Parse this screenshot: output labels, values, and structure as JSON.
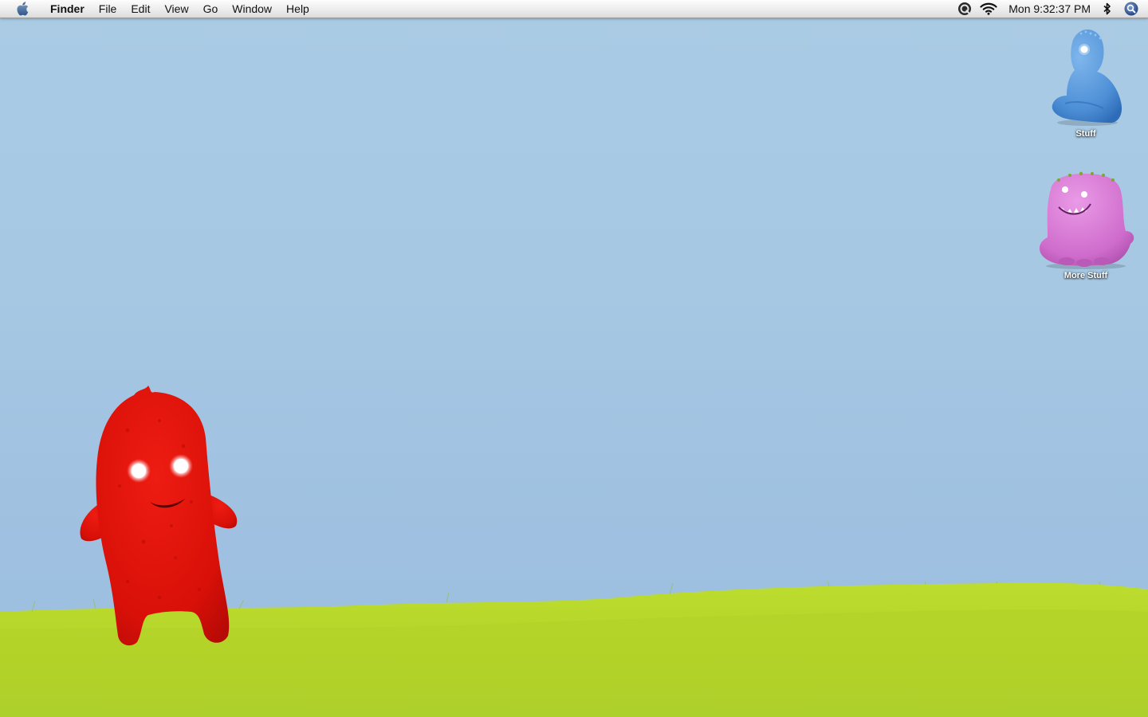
{
  "menubar": {
    "apple_icon": "apple-icon",
    "app_name": "Finder",
    "items": [
      "File",
      "Edit",
      "View",
      "Go",
      "Window",
      "Help"
    ],
    "status_icons": [
      "quicktime-icon",
      "wifi-icon"
    ],
    "clock": "Mon 9:32:37 PM",
    "right_icons": [
      "bluetooth-icon",
      "spotlight-icon"
    ]
  },
  "desktop": {
    "icons": [
      {
        "label": "Stuff",
        "icon": "blue-monster-folder-icon"
      },
      {
        "label": "More Stuff",
        "icon": "pink-monster-folder-icon"
      }
    ],
    "wallpaper": {
      "sky_color": "#a6c8e3",
      "grass_color": "#b5d62a",
      "character_color": "#e01010"
    }
  }
}
